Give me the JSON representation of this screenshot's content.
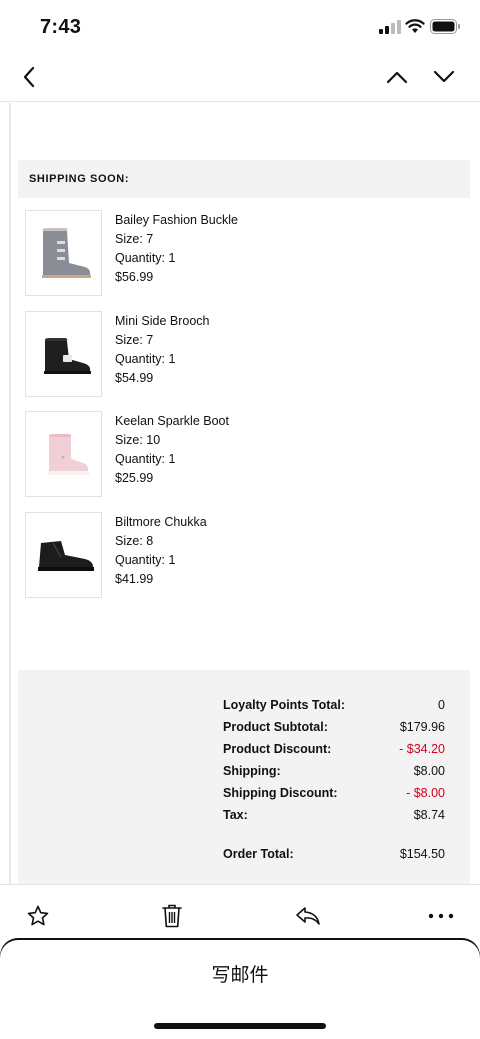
{
  "status_bar": {
    "time": "7:43",
    "icons": [
      "cellular-signal-icon",
      "wifi-icon",
      "battery-icon"
    ]
  },
  "nav": {
    "back_icon": "chevron-left-icon",
    "prev_icon": "chevron-up-icon",
    "next_icon": "chevron-down-icon"
  },
  "email": {
    "section_title": "SHIPPING SOON:",
    "items": [
      {
        "name": "Bailey Fashion Buckle",
        "size": "Size: 7",
        "quantity": "Quantity: 1",
        "price": "$56.99",
        "image": "grey-buckle-boot"
      },
      {
        "name": "Mini Side Brooch",
        "size": "Size: 7",
        "quantity": "Quantity: 1",
        "price": "$54.99",
        "image": "black-brooch-boot"
      },
      {
        "name": "Keelan Sparkle Boot",
        "size": "Size: 10",
        "quantity": "Quantity: 1",
        "price": "$25.99",
        "image": "pink-sparkle-boot"
      },
      {
        "name": "Biltmore Chukka",
        "size": "Size: 8",
        "quantity": "Quantity: 1",
        "price": "$41.99",
        "image": "black-chukka-boot"
      }
    ],
    "summary": {
      "loyalty": {
        "label": "Loyalty Points Total:",
        "value": "0"
      },
      "subtotal": {
        "label": "Product Subtotal:",
        "value": "$179.96"
      },
      "discount": {
        "label": "Product Discount:",
        "value": "- $34.20"
      },
      "shipping": {
        "label": "Shipping:",
        "value": "$8.00"
      },
      "shipping_discount": {
        "label": "Shipping Discount:",
        "value": "- $8.00"
      },
      "tax": {
        "label": "Tax:",
        "value": "$8.74"
      },
      "order_total": {
        "label": "Order Total:",
        "value": "$154.50"
      }
    }
  },
  "toolbar": {
    "icons": [
      "star-icon",
      "trash-icon",
      "reply-icon",
      "more-icon"
    ]
  },
  "compose": {
    "label": "写邮件"
  },
  "colors": {
    "discount_red": "#d0021b",
    "panel_grey": "#f3f3f3"
  }
}
